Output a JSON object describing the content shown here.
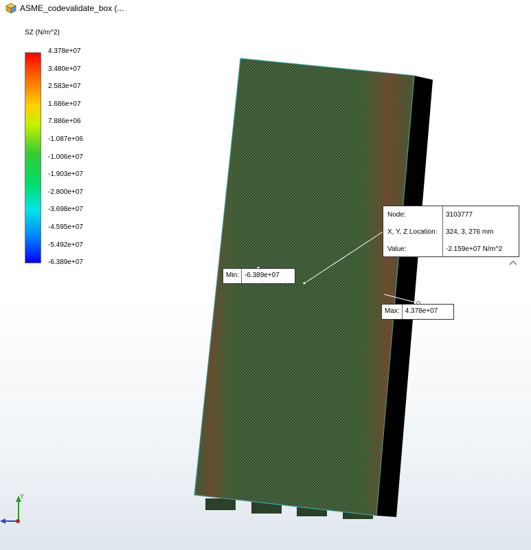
{
  "window": {
    "title": "ASME_codevalidate_box  (..."
  },
  "legend": {
    "title": "SZ (N/m^2)",
    "ticks": [
      "4.378e+07",
      "3.480e+07",
      "2.583e+07",
      "1.686e+07",
      "7.886e+06",
      "-1.087e+06",
      "-1.006e+07",
      "-1.903e+07",
      "-2.800e+07",
      "-3.698e+07",
      "-4.595e+07",
      "-5.492e+07",
      "-6.389e+07"
    ]
  },
  "min_callout": {
    "label": "Min:",
    "value": "-6.389e+07"
  },
  "max_callout": {
    "label": "Max:",
    "value": "4.378e+07"
  },
  "probe": {
    "node_label": "Node:",
    "node_value": "3103777",
    "location_label": "X, Y, Z Location:",
    "location_value": "324, 3, 276 mm",
    "value_label": "Value:",
    "value_value": "-2.159e+07 N/m^2"
  },
  "triad": {
    "y_label": "Y"
  },
  "icons": {
    "title": "part-icon",
    "collapse": "chevron-up-icon"
  },
  "colors": {
    "mesh": "#2f4a2a",
    "edge": "#3aa6a6",
    "max": "#ff0000",
    "min": "#0000ff"
  }
}
